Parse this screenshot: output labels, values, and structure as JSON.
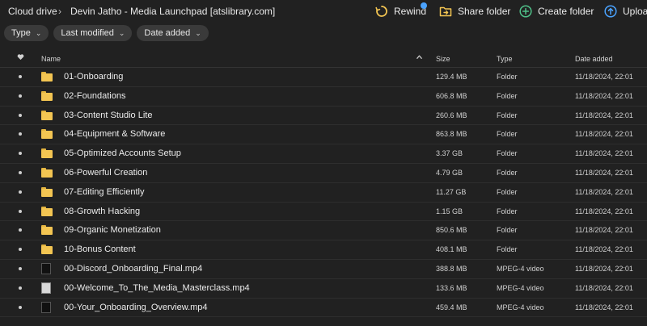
{
  "breadcrumb": {
    "root": "Cloud drive",
    "separator": "›",
    "current": "Devin Jatho - Media Launchpad [atslibrary.com]"
  },
  "actions": {
    "rewind": "Rewind",
    "share_folder": "Share folder",
    "create_folder": "Create folder",
    "upload": "Upload"
  },
  "filters": {
    "type": "Type",
    "last_modified": "Last modified",
    "date_added": "Date added"
  },
  "table": {
    "headers": {
      "name": "Name",
      "size": "Size",
      "type": "Type",
      "date_added": "Date added"
    },
    "rows": [
      {
        "name": "01-Onboarding",
        "size": "129.4 MB",
        "type": "Folder",
        "date": "11/18/2024, 22:01"
      },
      {
        "name": "02-Foundations",
        "size": "606.8 MB",
        "type": "Folder",
        "date": "11/18/2024, 22:01"
      },
      {
        "name": "03-Content Studio Lite",
        "size": "260.6 MB",
        "type": "Folder",
        "date": "11/18/2024, 22:01"
      },
      {
        "name": "04-Equipment & Software",
        "size": "863.8 MB",
        "type": "Folder",
        "date": "11/18/2024, 22:01"
      },
      {
        "name": "05-Optimized Accounts Setup",
        "size": "3.37 GB",
        "type": "Folder",
        "date": "11/18/2024, 22:01"
      },
      {
        "name": "06-Powerful Creation",
        "size": "4.79 GB",
        "type": "Folder",
        "date": "11/18/2024, 22:01"
      },
      {
        "name": "07-Editing Efficiently",
        "size": "11.27 GB",
        "type": "Folder",
        "date": "11/18/2024, 22:01"
      },
      {
        "name": "08-Growth Hacking",
        "size": "1.15 GB",
        "type": "Folder",
        "date": "11/18/2024, 22:01"
      },
      {
        "name": "09-Organic Monetization",
        "size": "850.6 MB",
        "type": "Folder",
        "date": "11/18/2024, 22:01"
      },
      {
        "name": "10-Bonus Content",
        "size": "408.1 MB",
        "type": "Folder",
        "date": "11/18/2024, 22:01"
      },
      {
        "name": "00-Discord_Onboarding_Final.mp4",
        "size": "388.8 MB",
        "type": "MPEG-4 video",
        "date": "11/18/2024, 22:01"
      },
      {
        "name": "00-Welcome_To_The_Media_Masterclass.mp4",
        "size": "133.6 MB",
        "type": "MPEG-4 video",
        "date": "11/18/2024, 22:01"
      },
      {
        "name": "00-Your_Onboarding_Overview.mp4",
        "size": "459.4 MB",
        "type": "MPEG-4 video",
        "date": "11/18/2024, 22:01"
      }
    ]
  },
  "icons": {
    "rewind": "rewind-icon",
    "share_folder": "share-folder-icon",
    "create_folder": "plus-circle-icon",
    "upload": "upload-icon",
    "folder": "folder-icon",
    "video": "video-thumbnail-icon",
    "favourite_header": "heart-icon",
    "sort": "sort-ascending-icon"
  },
  "colors": {
    "background": "#212121",
    "accent_yellow": "#f3c552",
    "accent_green": "#4fbf88",
    "accent_blue": "#4aa3ff"
  }
}
